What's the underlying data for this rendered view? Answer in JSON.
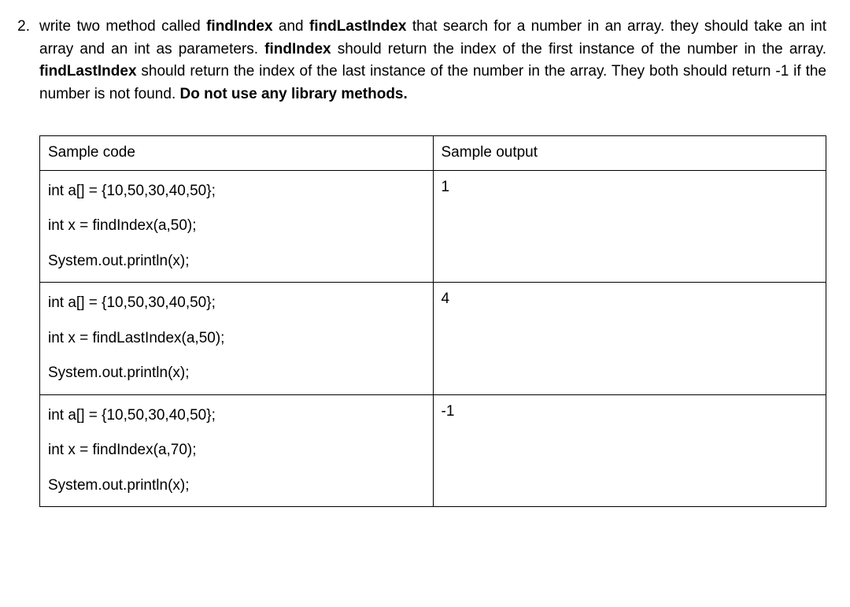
{
  "question": {
    "number": "2.",
    "text_parts": [
      "write two method called ",
      "findIndex",
      " and ",
      "findLastIndex",
      " that search for a number in an array. they should take an int array and an int as parameters. ",
      "findIndex",
      " should return the index of the first instance of the number in the array.  ",
      "findLastIndex",
      " should return the index of the last instance of the number in the array. They both should return -1 if the number is not found. ",
      "Do not use any library methods."
    ]
  },
  "table": {
    "headers": {
      "code": "Sample code",
      "output": "Sample output"
    },
    "rows": [
      {
        "code": [
          "int a[] = {10,50,30,40,50};",
          "int x = findIndex(a,50);",
          "System.out.println(x);"
        ],
        "output": "1"
      },
      {
        "code": [
          "int a[] = {10,50,30,40,50};",
          "int x = findLastIndex(a,50);",
          "System.out.println(x);"
        ],
        "output": "4"
      },
      {
        "code": [
          "int a[] = {10,50,30,40,50};",
          "int x = findIndex(a,70);",
          "System.out.println(x);"
        ],
        "output": "-1"
      }
    ]
  }
}
